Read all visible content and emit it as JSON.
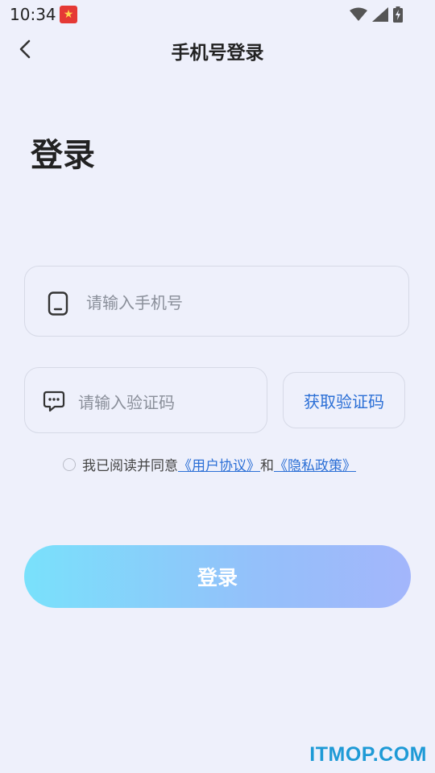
{
  "status_bar": {
    "time": "10:34"
  },
  "header": {
    "title": "手机号登录"
  },
  "page_title": "登录",
  "phone_input": {
    "value": "",
    "placeholder": "请输入手机号"
  },
  "code_input": {
    "value": "",
    "placeholder": "请输入验证码"
  },
  "get_code_label": "获取验证码",
  "agreement": {
    "prefix": "我已阅读并同意",
    "user_agreement": "《用户协议》",
    "conjunction": "和",
    "privacy_policy": "《隐私政策》",
    "checked": false
  },
  "login_label": "登录",
  "watermark": "ITMOP.COM",
  "colors": {
    "background": "#eef0fb",
    "link": "#2b6fd6",
    "button_gradient_start": "#79e1fb",
    "button_gradient_end": "#a3b6fb",
    "watermark": "#1e9ad6"
  },
  "icons": {
    "back": "chevron-left-icon",
    "phone": "phone-icon",
    "message": "message-icon",
    "wifi": "wifi-icon",
    "signal": "signal-icon",
    "battery": "battery-charging-icon",
    "notification": "app-notification-icon"
  }
}
